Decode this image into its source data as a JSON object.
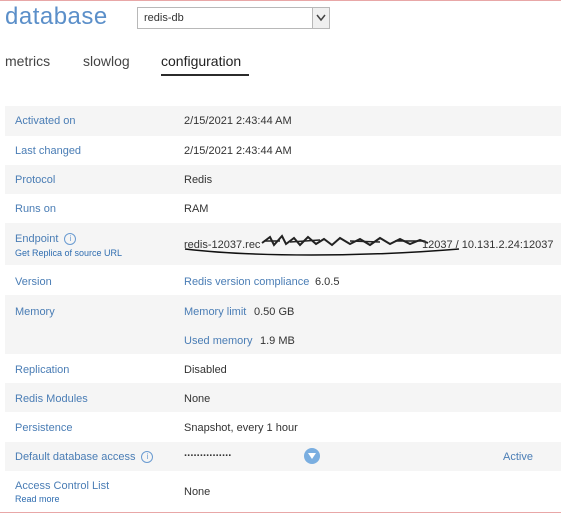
{
  "header": {
    "title": "database",
    "db_select_value": "redis-db"
  },
  "tabs": [
    {
      "label": "metrics"
    },
    {
      "label": "slowlog"
    },
    {
      "label": "configuration",
      "active": true
    }
  ],
  "config": {
    "activated_on": {
      "label": "Activated on",
      "value": "2/15/2021 2:43:44 AM"
    },
    "last_changed": {
      "label": "Last changed",
      "value": "2/15/2021 2:43:44 AM"
    },
    "protocol": {
      "label": "Protocol",
      "value": "Redis"
    },
    "runs_on": {
      "label": "Runs on",
      "value": "RAM"
    },
    "endpoint": {
      "label": "Endpoint",
      "sublink": "Get Replica of source URL",
      "value_start": "redis-12037.rec",
      "value_end": "12037 / 10.131.2.24:12037"
    },
    "version": {
      "label": "Version",
      "compliance_label": "Redis version compliance",
      "value": "6.0.5"
    },
    "memory": {
      "label": "Memory",
      "limit_label": "Memory limit",
      "limit_value": "0.50 GB",
      "used_label": "Used memory",
      "used_value": "1.9 MB"
    },
    "replication": {
      "label": "Replication",
      "value": "Disabled"
    },
    "redis_modules": {
      "label": "Redis Modules",
      "value": "None"
    },
    "persistence": {
      "label": "Persistence",
      "value": "Snapshot, every 1 hour"
    },
    "default_access": {
      "label": "Default database access",
      "value": "···············",
      "status": "Active"
    },
    "acl": {
      "label": "Access Control List",
      "sublink": "Read more",
      "value": "None"
    }
  },
  "colors": {
    "accent": "#4a7db5",
    "title": "#5b8fc9",
    "rule": "#e8a7a7"
  },
  "icons": [
    "info-icon",
    "chevron-down-icon"
  ]
}
